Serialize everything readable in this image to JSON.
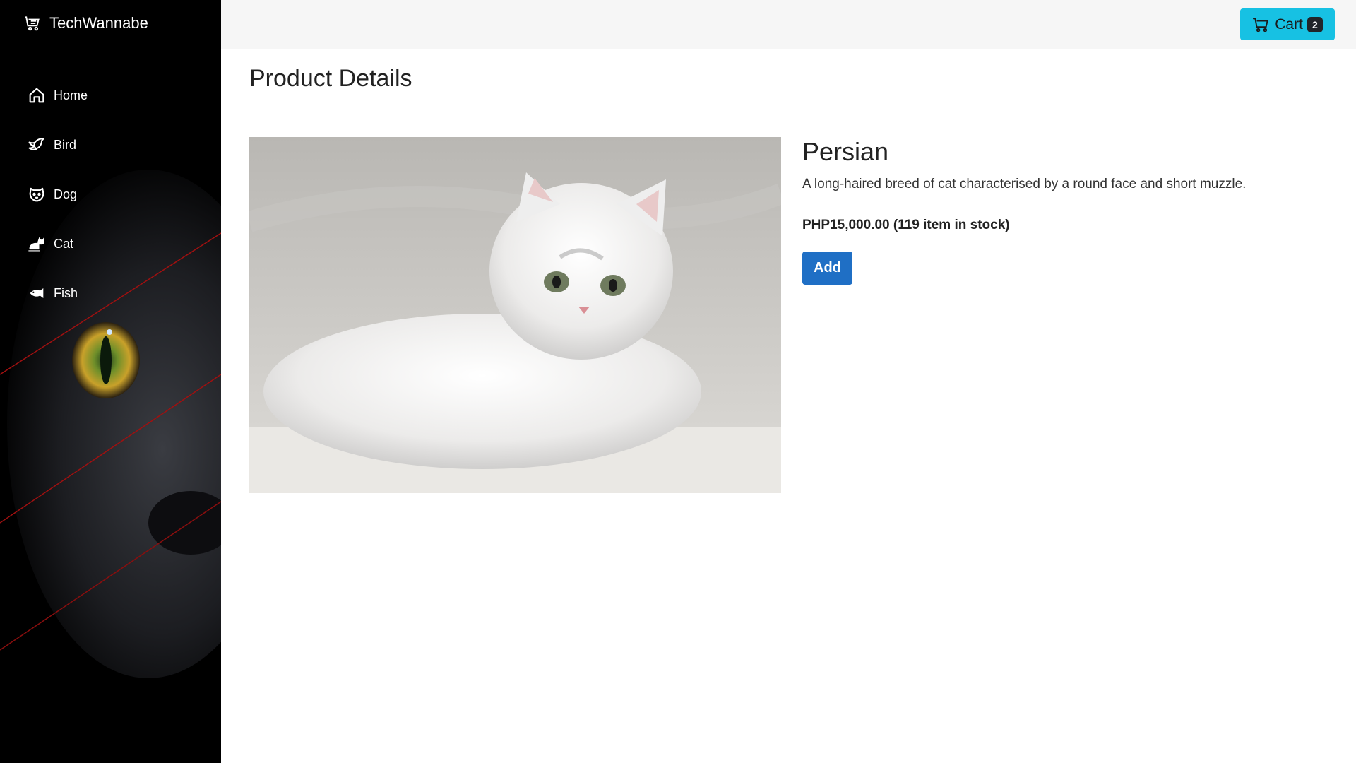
{
  "brand": {
    "name": "TechWannabe",
    "icon": "cart-list-icon"
  },
  "sidebar": {
    "items": [
      {
        "label": "Home",
        "icon": "home-icon"
      },
      {
        "label": "Bird",
        "icon": "bird-icon"
      },
      {
        "label": "Dog",
        "icon": "dog-icon"
      },
      {
        "label": "Cat",
        "icon": "cat-icon"
      },
      {
        "label": "Fish",
        "icon": "fish-icon"
      }
    ]
  },
  "topbar": {
    "cart_label": "Cart",
    "cart_count": "2",
    "cart_color": "#17c1e3"
  },
  "page": {
    "title": "Product Details"
  },
  "product": {
    "name": "Persian",
    "description": "A long-haired breed of cat characterised by a round face and short muzzle.",
    "price_line": "PHP15,000.00 (119 item in stock)",
    "add_label": "Add",
    "image": "white-persian-cat-photo"
  },
  "colors": {
    "sidebar_bg": "#000000",
    "primary_button": "#1f6fc5",
    "cart_button": "#17c1e3"
  }
}
